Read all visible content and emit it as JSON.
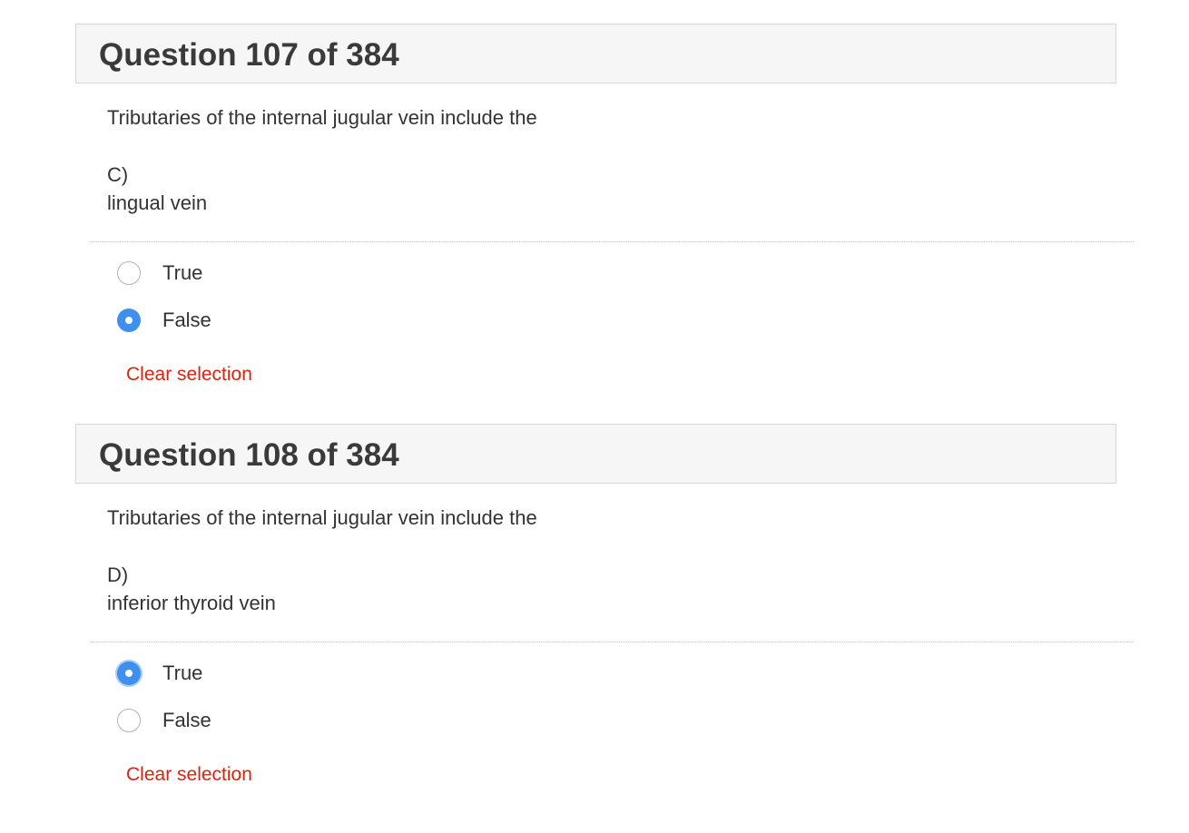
{
  "questions": [
    {
      "title": "Question 107 of 384",
      "stem": "Tributaries of the internal jugular vein include the",
      "letter": "C)",
      "option_text": "lingual vein",
      "choices": [
        {
          "label": "True",
          "checked": false
        },
        {
          "label": "False",
          "checked": true
        }
      ],
      "clear_label": "Clear selection"
    },
    {
      "title": "Question 108 of 384",
      "stem": "Tributaries of the internal jugular vein include the",
      "letter": "D)",
      "option_text": "inferior thyroid vein",
      "choices": [
        {
          "label": "True",
          "checked": true
        },
        {
          "label": "False",
          "checked": false
        }
      ],
      "clear_label": "Clear selection"
    }
  ],
  "colors": {
    "accent": "#3e8fee",
    "link": "#d9230f",
    "header_bg": "#f6f6f6",
    "text": "#333333"
  }
}
